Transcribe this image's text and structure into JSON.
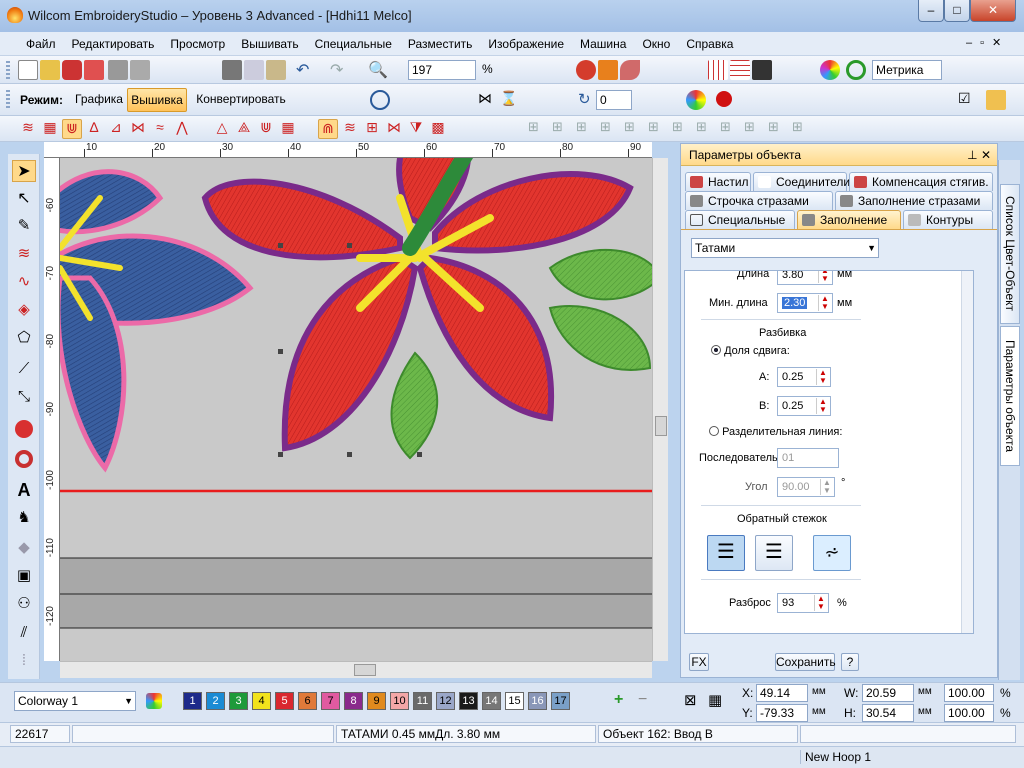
{
  "window": {
    "title": "Wilcom EmbroideryStudio – Уровень 3 Advanced - [Hdhi11         Melco]",
    "min": "–",
    "max": "□",
    "close": "✕"
  },
  "menu": [
    "Файл",
    "Редактировать",
    "Просмотр",
    "Вышивать",
    "Специальные",
    "Разместить",
    "Изображение",
    "Машина",
    "Окно",
    "Справка"
  ],
  "toolbar1": {
    "zoom": "197",
    "zoom_unit": "%",
    "units": "Метрика"
  },
  "toolbar2": {
    "mode_label": "Режим:",
    "mode_graphics": "Графика",
    "mode_embroidery": "Вышивка",
    "mode_convert": "Конвертировать",
    "angle": "0"
  },
  "ruler": {
    "h_ticks": [
      "10",
      "20",
      "30",
      "40",
      "50",
      "60",
      "70",
      "80",
      "90"
    ],
    "v_ticks": [
      "-60",
      "-70",
      "-80",
      "-90",
      "-100",
      "-110",
      "-120"
    ]
  },
  "panel": {
    "title": "Параметры объекта",
    "tabs_row1": [
      "Настил",
      "Соединители",
      "Компенсация стягив."
    ],
    "tabs_row2": [
      "Строчка стразами",
      "Заполнение стразами"
    ],
    "tabs_row3": [
      "Специальные",
      "Заполнение",
      "Контуры"
    ],
    "fill_type": "Татами",
    "length_label": "Длина",
    "length_value": "3.80",
    "unit_mm": "мм",
    "min_length_label": "Мин. длина",
    "min_length_value": "2.30",
    "split_label": "Разбивка",
    "offset_label": "Доля сдвига:",
    "a_label": "A:",
    "a_value": "0.25",
    "b_label": "B:",
    "b_value": "0.25",
    "divider_label": "Разделительная линия:",
    "sequence_label": "Последователь",
    "sequence_value": "01",
    "angle_label": "Угол",
    "angle_value": "90.00",
    "angle_unit": "°",
    "backstitch_label": "Обратный стежок",
    "spread_label": "Разброс",
    "spread_value": "93",
    "spread_unit": "%",
    "fx": "FX",
    "save": "Сохранить",
    "help": "?"
  },
  "right_tabs": [
    "Список Цвет-Объект",
    "Параметры объекта"
  ],
  "colorway": {
    "name": "Colorway 1",
    "swatches": [
      {
        "n": "1",
        "c": "#1e2a8a"
      },
      {
        "n": "2",
        "c": "#1b8bd4"
      },
      {
        "n": "3",
        "c": "#1e9a3a"
      },
      {
        "n": "4",
        "c": "#f2e21c"
      },
      {
        "n": "5",
        "c": "#d9282f"
      },
      {
        "n": "6",
        "c": "#e07a3a"
      },
      {
        "n": "7",
        "c": "#e05aa0"
      },
      {
        "n": "8",
        "c": "#8a2a8c"
      },
      {
        "n": "9",
        "c": "#e08a1e"
      },
      {
        "n": "10",
        "c": "#f4a7a7"
      },
      {
        "n": "11",
        "c": "#6a6a6a"
      },
      {
        "n": "12",
        "c": "#9aa7c9"
      },
      {
        "n": "13",
        "c": "#1a1a1a"
      },
      {
        "n": "14",
        "c": "#777777"
      },
      {
        "n": "15",
        "c": "#ffffff"
      },
      {
        "n": "16",
        "c": "#8a97b8"
      },
      {
        "n": "17",
        "c": "#7aa0c8"
      }
    ]
  },
  "coords": {
    "x_label": "X:",
    "x": "49.14",
    "y_label": "Y:",
    "y": "-79.33",
    "w_label": "W:",
    "w": "20.59",
    "h_label": "H:",
    "h": "30.54",
    "unit": "мм",
    "w_pct": "100.00",
    "h_pct": "100.00",
    "pct": "%"
  },
  "status": {
    "count": "22617",
    "stitch_info": "ТАТАМИ 0.45 ммДл. 3.80 мм",
    "object_info": "Объект 162: Ввод В"
  },
  "hoop": "New Hoop 1"
}
